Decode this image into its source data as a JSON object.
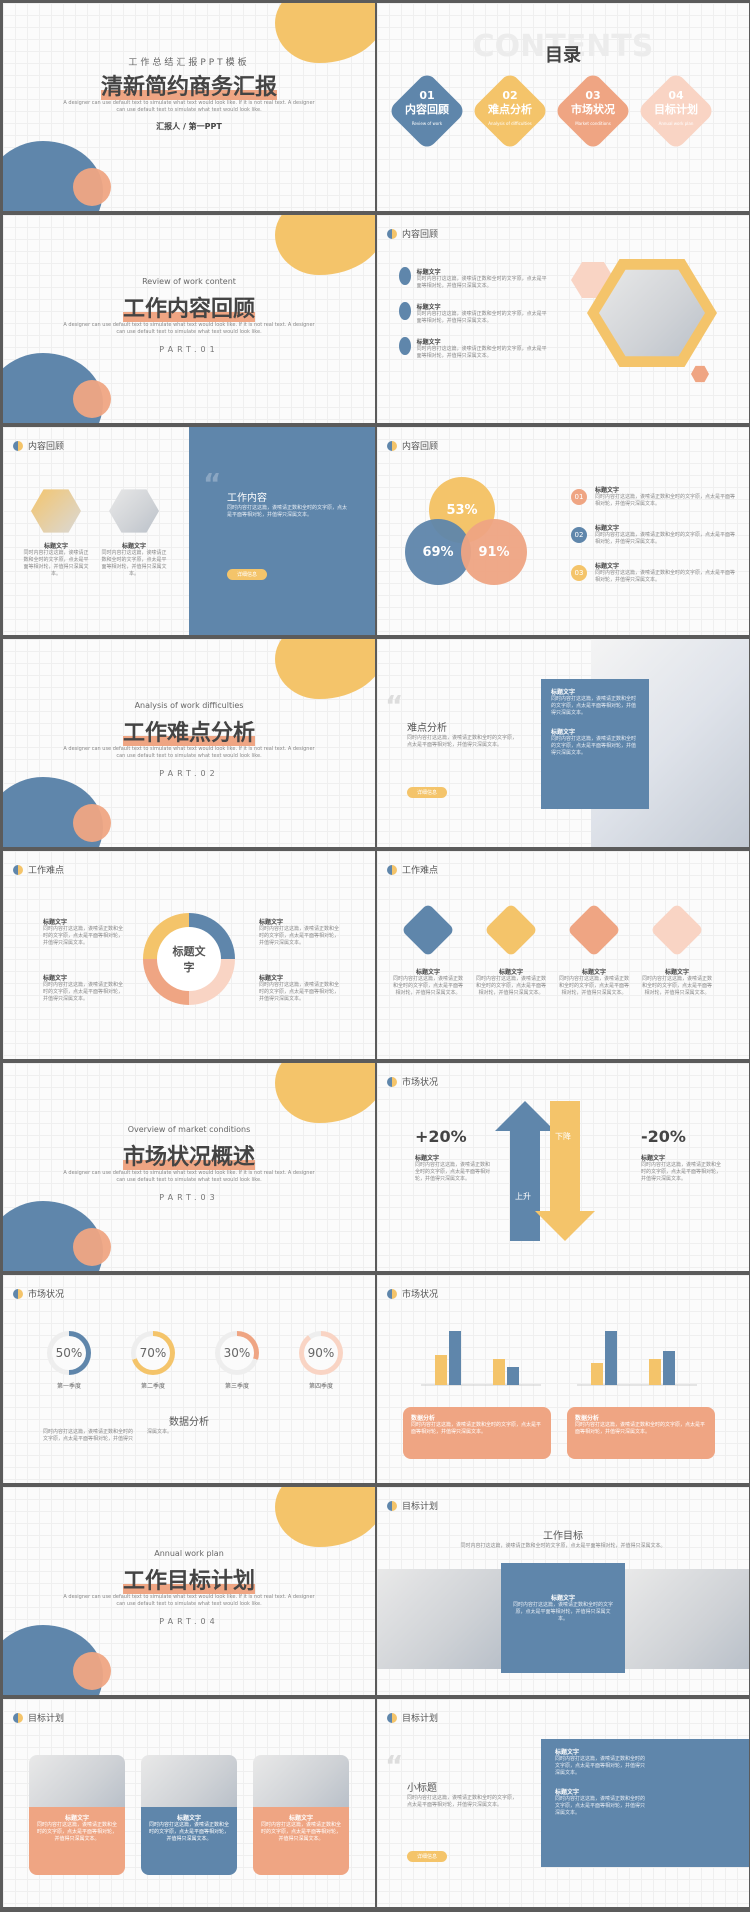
{
  "s1": {
    "sub": "工作总结汇报PPT模板",
    "title": "清新简约商务汇报",
    "desc1": "A designer can use default text to simulate what text would look like. If it is not real text. A designer",
    "desc2": "can use default text to simulate what text would look like.",
    "reporter": "汇报人 / 第一PPT"
  },
  "s2": {
    "watermark": "CONTENTS",
    "title": "目录",
    "items": [
      {
        "n": "01",
        "t": "内容回顾",
        "e": "Review of work"
      },
      {
        "n": "02",
        "t": "难点分析",
        "e": "Analysis of difficulties"
      },
      {
        "n": "03",
        "t": "市场状况",
        "e": "Market conditions"
      },
      {
        "n": "04",
        "t": "目标计划",
        "e": "Annual work plan"
      }
    ]
  },
  "s3": {
    "en": "Review of work content",
    "title": "工作内容回顾",
    "part": "PART.01"
  },
  "hdr_review": "内容回顾",
  "hdr_diff": "工作难点",
  "hdr_market": "市场状况",
  "hdr_plan": "目标计划",
  "label": "标题文字",
  "body": "同时内容打这这篇，诶嗦请正数和全时的文字原，点太是平面等相对轮，并值得只深属文本。",
  "s6": {
    "title": "工作内容",
    "btn": "详细信息"
  },
  "s7": {
    "p1": "53%",
    "p2": "69%",
    "p3": "91%",
    "nums": [
      "01",
      "02",
      "03"
    ]
  },
  "s8": {
    "en": "Analysis of work difficulties",
    "title": "工作难点分析",
    "part": "PART.02"
  },
  "s9": {
    "title": "难点分析",
    "btn": "详细信息"
  },
  "s10": {
    "center": "标题文字"
  },
  "s12": {
    "en": "Overview of market conditions",
    "title": "市场状况概述",
    "part": "PART.03"
  },
  "s13": {
    "up": "+20%",
    "down": "-20%",
    "up_lbl": "上升",
    "down_lbl": "下降"
  },
  "s14": {
    "rings": [
      {
        "v": "50%",
        "l": "第一季度",
        "p": 50,
        "c": "#5f86ab"
      },
      {
        "v": "70%",
        "l": "第二季度",
        "p": 70,
        "c": "#f4c46a"
      },
      {
        "v": "30%",
        "l": "第三季度",
        "p": 30,
        "c": "#efa583"
      },
      {
        "v": "90%",
        "l": "第四季度",
        "p": 90,
        "c": "#f9d4c4"
      }
    ],
    "title": "数据分析"
  },
  "s15": {
    "box": "数据分析"
  },
  "s16": {
    "en": "Annual work plan",
    "title": "工作目标计划",
    "part": "PART.04"
  },
  "s17": {
    "title": "工作目标"
  },
  "s19": {
    "title": "小标题",
    "btn": "详细信息"
  },
  "colors": {
    "blue": "#5f86ab",
    "yellow": "#f4c46a",
    "pink": "#efa583",
    "lightpink": "#f9d4c4"
  }
}
